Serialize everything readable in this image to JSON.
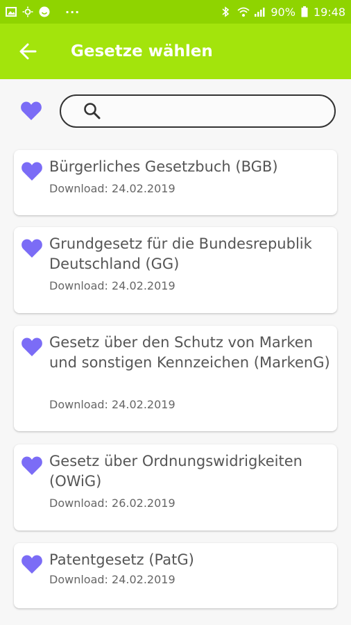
{
  "status": {
    "battery": "90%",
    "time": "19:48",
    "dots": "···"
  },
  "appbar": {
    "title": "Gesetze wählen"
  },
  "search": {
    "value": "",
    "placeholder": ""
  },
  "colors": {
    "accent": "#a3e40c",
    "statusbar": "#8fd400",
    "heart": "#7b6cf6"
  },
  "laws": [
    {
      "title": "Bürgerliches Gesetzbuch (BGB)",
      "download": "Download: 24.02.2019"
    },
    {
      "title": "Grundgesetz für die Bundesrepublik Deutschland (GG)",
      "download": "Download: 24.02.2019"
    },
    {
      "title": "Gesetz über den Schutz von Marken und sonstigen Kennzeichen (MarkenG)",
      "download": "Download: 24.02.2019"
    },
    {
      "title": "Gesetz über Ordnungswidrigkeiten (OWiG)",
      "download": "Download: 26.02.2019"
    },
    {
      "title": "Patentgesetz (PatG)",
      "download": "Download: 24.02.2019"
    }
  ]
}
